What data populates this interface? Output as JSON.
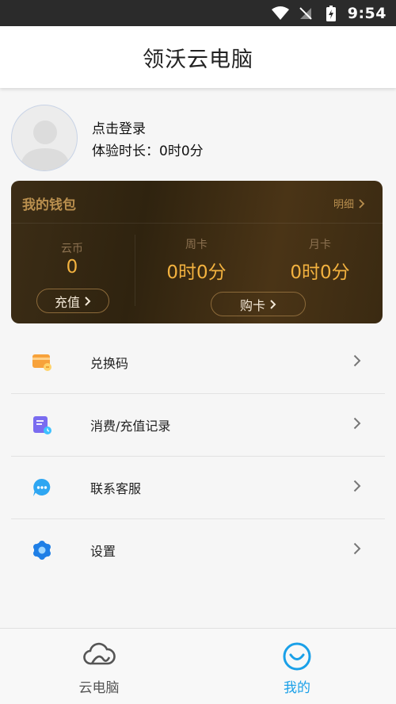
{
  "status_bar": {
    "time": "9:54"
  },
  "app_bar": {
    "title": "领沃云电脑"
  },
  "profile": {
    "login_label": "点击登录",
    "trial_label": "体验时长：",
    "trial_value": "0时0分"
  },
  "wallet": {
    "title": "我的钱包",
    "detail_label": "明细",
    "coin_label": "云币",
    "coin_value": "0",
    "recharge_label": "充值",
    "weekly_label": "周卡",
    "weekly_value": "0时0分",
    "monthly_label": "月卡",
    "monthly_value": "0时0分",
    "buy_card_label": "购卡"
  },
  "menu": {
    "items": [
      {
        "label": "兑换码",
        "icon": "redeem-code-icon"
      },
      {
        "label": "消费/充值记录",
        "icon": "records-icon"
      },
      {
        "label": "联系客服",
        "icon": "customer-service-icon"
      },
      {
        "label": "设置",
        "icon": "settings-icon"
      }
    ]
  },
  "tab_bar": {
    "tabs": [
      {
        "label": "云电脑",
        "icon": "cloud-icon",
        "active": false
      },
      {
        "label": "我的",
        "icon": "smile-icon",
        "active": true
      }
    ]
  },
  "colors": {
    "accent_blue": "#1aa0e8",
    "wallet_gold": "#f3b23f",
    "wallet_title": "#b98f4e"
  }
}
